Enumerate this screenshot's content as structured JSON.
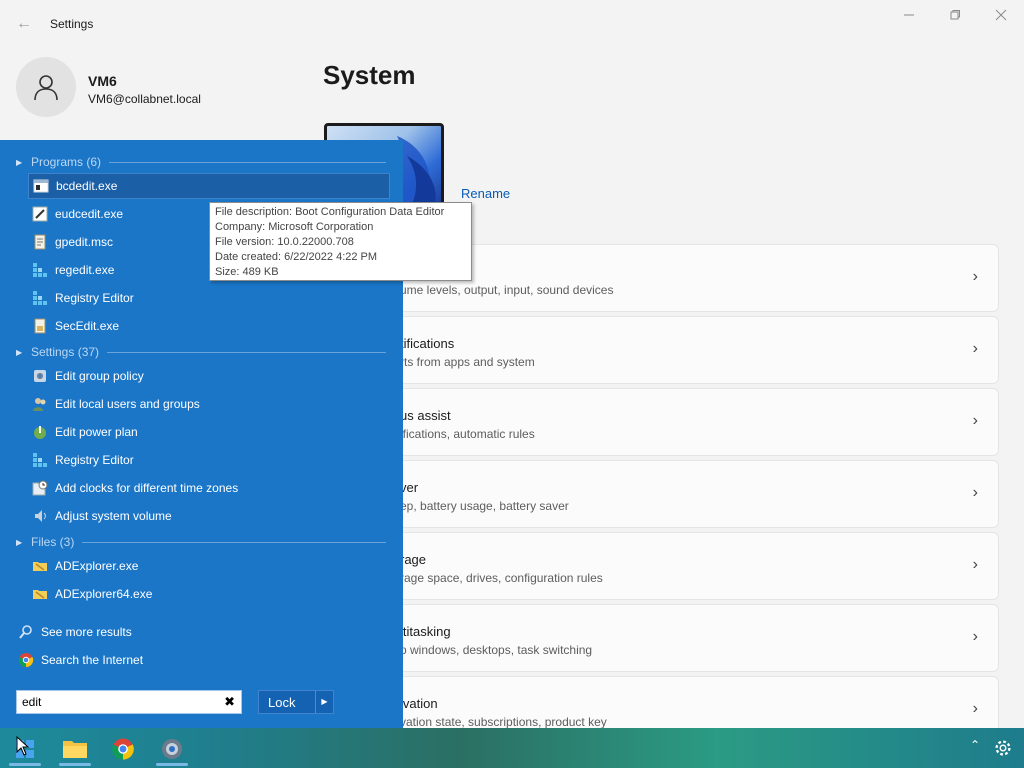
{
  "window": {
    "title": "Settings",
    "back_icon": "arrow-left-icon",
    "controls": [
      "minimize-icon",
      "maximize-icon",
      "close-icon"
    ]
  },
  "user": {
    "name": "VM6",
    "email": "VM6@collabnet.local"
  },
  "page": {
    "title": "System",
    "rename_label": "Rename"
  },
  "cards": [
    {
      "title": "",
      "subtitle": "ume levels, output, input, sound devices"
    },
    {
      "title": "tifications",
      "subtitle": "rts from apps and system"
    },
    {
      "title": "us assist",
      "subtitle": "ifications, automatic rules"
    },
    {
      "title": "ver",
      "subtitle": "ep, battery usage, battery saver"
    },
    {
      "title": "rage",
      "subtitle": "rage space, drives, configuration rules"
    },
    {
      "title": "ltitasking",
      "subtitle": "p windows, desktops, task switching"
    },
    {
      "title": "ivation",
      "subtitle": "vation state, subscriptions, product key"
    }
  ],
  "start_menu": {
    "sections": {
      "programs": "Programs (6)",
      "settings": "Settings (37)",
      "files": "Files (3)"
    },
    "programs": [
      {
        "label": "bcdedit.exe",
        "icon": "console-app-icon"
      },
      {
        "label": "eudcedit.exe",
        "icon": "char-editor-icon"
      },
      {
        "label": "gpedit.msc",
        "icon": "policy-doc-icon"
      },
      {
        "label": "regedit.exe",
        "icon": "registry-icon"
      },
      {
        "label": "Registry Editor",
        "icon": "registry-icon"
      },
      {
        "label": "SecEdit.exe",
        "icon": "security-doc-icon"
      }
    ],
    "settings": [
      {
        "label": "Edit group policy",
        "icon": "policy-settings-icon"
      },
      {
        "label": "Edit local users and groups",
        "icon": "users-icon"
      },
      {
        "label": "Edit power plan",
        "icon": "power-plan-icon"
      },
      {
        "label": "Registry Editor",
        "icon": "registry-icon"
      },
      {
        "label": "Add clocks for different time zones",
        "icon": "clock-icon"
      },
      {
        "label": "Adjust system volume",
        "icon": "volume-icon"
      }
    ],
    "files": [
      {
        "label": "ADExplorer.exe",
        "icon": "folder-app-icon"
      },
      {
        "label": "ADExplorer64.exe",
        "icon": "folder-app-icon"
      }
    ],
    "see_more": "See more results",
    "search_internet": "Search the Internet",
    "search_value": "edit",
    "lock_label": "Lock"
  },
  "tooltip": {
    "description": "File description: Boot Configuration Data Editor",
    "company": "Company: Microsoft Corporation",
    "version": "File version: 10.0.22000.708",
    "date_created": "Date created: 6/22/2022 4:22 PM",
    "size": "Size: 489 KB"
  },
  "taskbar": {
    "apps": [
      "start-icon",
      "file-explorer-icon",
      "chrome-icon",
      "settings-icon"
    ],
    "tray": [
      "chevron-up-icon",
      "gear-icon"
    ]
  },
  "colors": {
    "start_menu_bg": "#1b76c8",
    "link": "#0a5bb5",
    "taskbar": "#1f7f8f"
  }
}
